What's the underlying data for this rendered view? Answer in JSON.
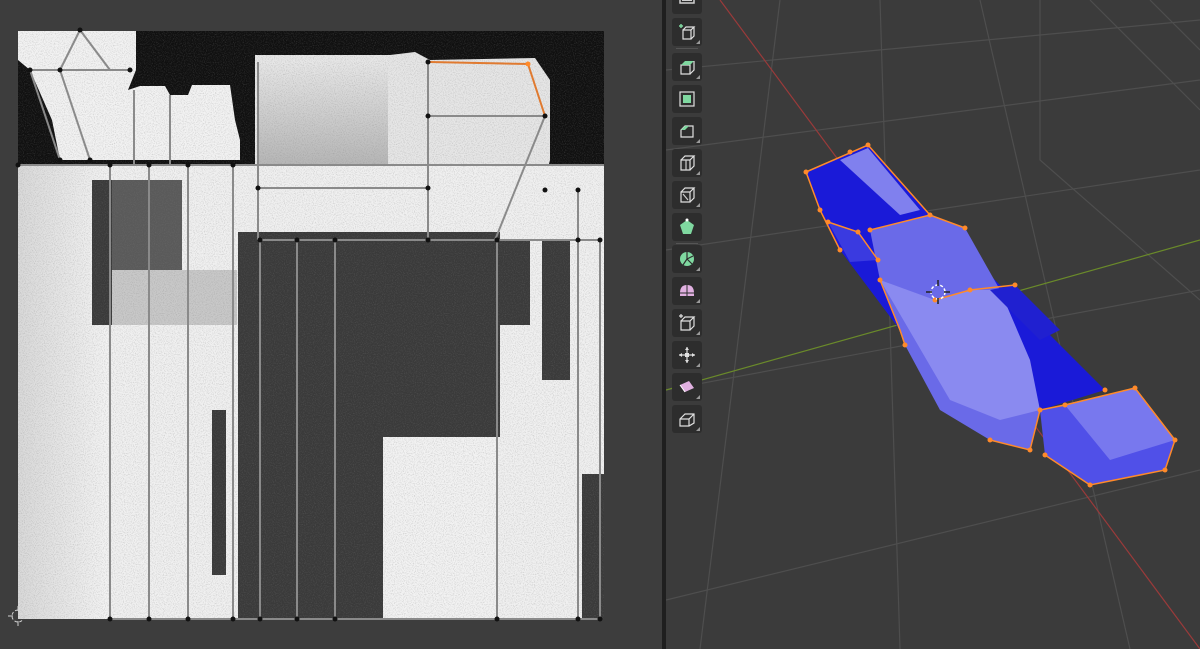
{
  "editors": {
    "uv_editor": {
      "background_color": "#3d3d3d",
      "texture_border_color": "#101010",
      "selected_edge_color": "#e07a30"
    },
    "viewport": {
      "background_color": "#3b3b3b",
      "grid_color": "#4e4e4e",
      "x_axis_color": "#9a3a3a",
      "y_axis_color": "#6a8a2a",
      "mesh_face_color": "#2828e0",
      "mesh_vertex_color": "#ff8a2a"
    }
  },
  "toolbar": {
    "tools": [
      {
        "name": "select-box-icon",
        "color": "#d0d0d0"
      },
      {
        "name": "add-cube-icon",
        "color": "#7fd8a0"
      },
      {
        "name": "extrude-region-icon",
        "color": "#7fd8a0"
      },
      {
        "name": "inset-faces-icon",
        "color": "#7fd8a0"
      },
      {
        "name": "bevel-icon",
        "color": "#7fd8a0"
      },
      {
        "name": "loop-cut-icon",
        "color": "#d0d0d0"
      },
      {
        "name": "knife-icon",
        "color": "#d0d0d0"
      },
      {
        "name": "poly-build-icon",
        "color": "#7fd8a0"
      },
      {
        "name": "spin-icon",
        "color": "#7fd8a0"
      },
      {
        "name": "smooth-icon",
        "color": "#e0b0e0"
      },
      {
        "name": "edge-slide-icon",
        "color": "#d0d0d0"
      },
      {
        "name": "shrink-fatten-icon",
        "color": "#d0d0d0"
      },
      {
        "name": "shear-icon",
        "color": "#e0b0e0"
      },
      {
        "name": "rip-region-icon",
        "color": "#d0d0d0"
      }
    ]
  }
}
